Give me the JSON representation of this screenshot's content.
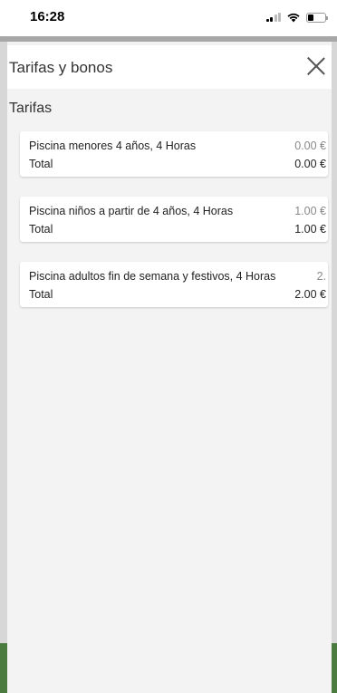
{
  "status_bar": {
    "time": "16:28"
  },
  "modal": {
    "title": "Tarifas y bonos",
    "section_title": "Tarifas",
    "tarifas": [
      {
        "name": "Piscina menores 4 años, 4 Horas",
        "price": "0.00 €",
        "total_label": "Total",
        "total_value": "0.00 €"
      },
      {
        "name": "Piscina niños a partir de 4 años, 4 Horas",
        "price": "1.00 €",
        "total_label": "Total",
        "total_value": "1.00 €"
      },
      {
        "name": "Piscina adultos fin de semana y festivos, 4 Horas",
        "price": "2.",
        "total_label": "Total",
        "total_value": "2.00 €"
      }
    ]
  },
  "icons": {
    "close": "close-icon",
    "signal": "signal-icon",
    "wifi": "wifi-icon",
    "battery": "battery-icon"
  }
}
